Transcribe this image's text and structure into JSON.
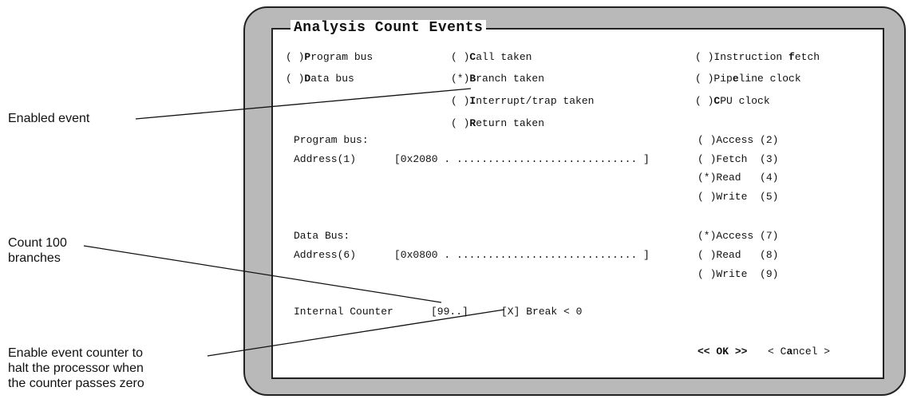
{
  "dialog": {
    "title": "Analysis Count Events"
  },
  "events": {
    "program_bus": {
      "mark": "( )",
      "hot": "P",
      "rest": "rogram bus"
    },
    "data_bus": {
      "mark": "( )",
      "hot": "D",
      "rest": "ata bus"
    },
    "call_taken": {
      "mark": "( )",
      "hot": "C",
      "rest": "all taken"
    },
    "branch_taken": {
      "mark": "(*)",
      "hot": "B",
      "rest": "ranch taken"
    },
    "interrupt": {
      "mark": "( )",
      "hot": "I",
      "rest": "nterrupt/trap taken"
    },
    "return_taken": {
      "mark": "( )",
      "hot": "R",
      "rest": "eturn taken"
    },
    "instr_fetch": {
      "mark": "( )",
      "pre": "Instruction ",
      "hot": "f",
      "rest": "etch"
    },
    "pipeline": {
      "mark": "( )",
      "pre": "Pip",
      "hot": "e",
      "rest": "line clock"
    },
    "cpu_clock": {
      "mark": "( )",
      "hot": "C",
      "rest": "PU clock"
    }
  },
  "program_bus": {
    "heading": "Program bus:",
    "address_label": "Address",
    "address_key": "(1)",
    "address_value": "[0x2080 . ............................. ]",
    "options": [
      {
        "mark": "( )",
        "label": "Access",
        "key": "(2)"
      },
      {
        "mark": "( )",
        "label": "Fetch",
        "key": "(3)"
      },
      {
        "mark": "(*)",
        "label": "Read",
        "key": "(4)"
      },
      {
        "mark": "( )",
        "label": "Write",
        "key": "(5)"
      }
    ]
  },
  "data_bus": {
    "heading": "Data Bus:",
    "address_label": "Address",
    "address_key": "(6)",
    "address_value": "[0x0800 . ............................. ]",
    "options": [
      {
        "mark": "(*)",
        "label": "Access",
        "key": "(7)"
      },
      {
        "mark": "( )",
        "label": "Read",
        "key": "(8)"
      },
      {
        "mark": "( )",
        "label": "Write",
        "key": "(9)"
      }
    ]
  },
  "counter": {
    "label": "Internal Counter",
    "value": "[99..]",
    "break_check": "[X]",
    "break_label": "Break < 0"
  },
  "buttons": {
    "ok_open": "<<",
    "ok_label": "OK",
    "ok_close": ">>",
    "cancel_open": "<",
    "cancel_pre": "C",
    "cancel_hot": "a",
    "cancel_rest": "ncel",
    "cancel_close": ">"
  },
  "callouts": {
    "enabled_event": "Enabled event",
    "count_line1": "Count 100",
    "count_line2": "branches",
    "enable_line1": "Enable event counter to",
    "enable_line2": "halt the processor when",
    "enable_line3": "the counter passes zero"
  }
}
